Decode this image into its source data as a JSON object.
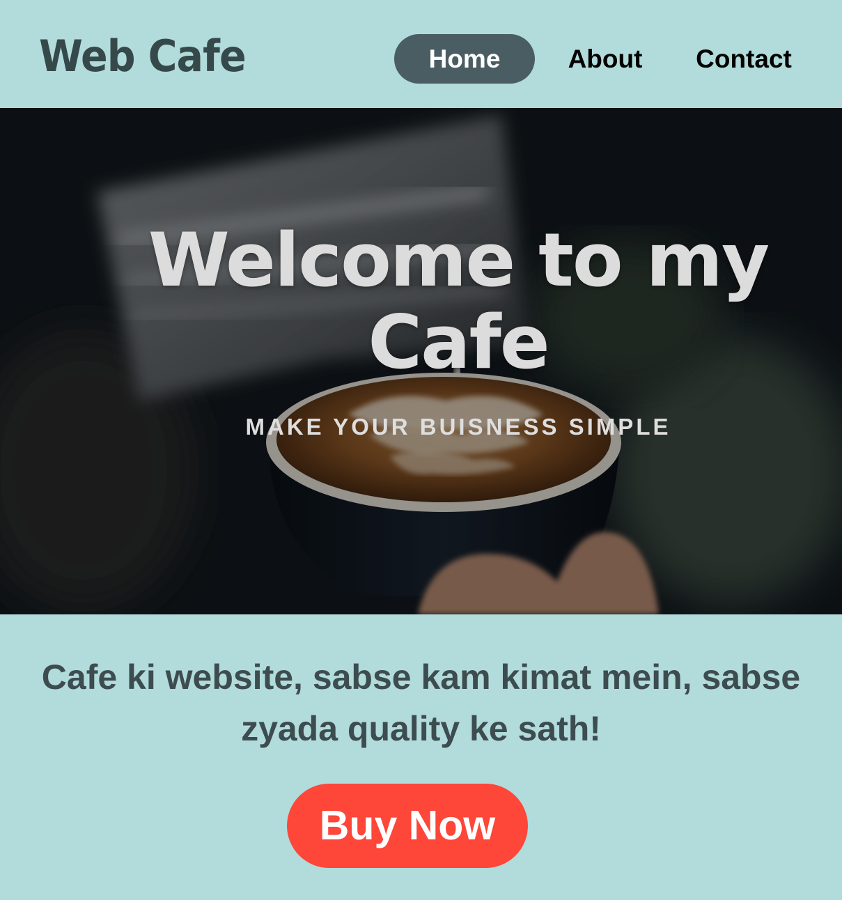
{
  "header": {
    "logo": "Web Cafe",
    "nav": {
      "home": "Home",
      "about": "About",
      "contact": "Contact"
    },
    "active_item": "Home"
  },
  "hero": {
    "title_line1": "Welcome to my",
    "title_line2": "Cafe",
    "subtitle": "MAKE YOUR BUISNESS SIMPLE"
  },
  "main": {
    "tagline": "Cafe ki website, sabse kam kimat mein, sabse zyada quality ke sath!",
    "cta_label": "Buy Now"
  },
  "colors": {
    "background": "#b2dbdc",
    "logo_text": "#36494a",
    "nav_active_bg": "#4a5d62",
    "tagline_text": "#3d4c4f",
    "cta_bg": "#fe4639"
  }
}
